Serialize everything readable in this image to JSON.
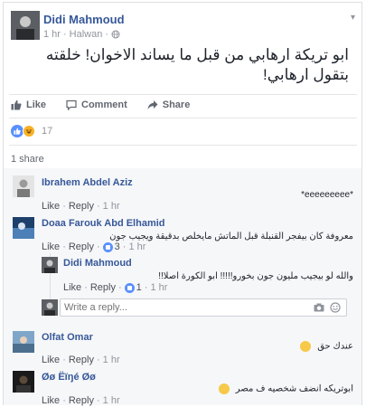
{
  "post": {
    "author": "Didi Mahmoud",
    "time": "1 hr",
    "location": "Halwan",
    "text": "ابو تريكة ارهابي من قبل ما يساند الاخوان! خلقته بتقول ارهابي!"
  },
  "actions": {
    "like": "Like",
    "comment": "Comment",
    "share": "Share"
  },
  "reactions": {
    "count": "17"
  },
  "shares": {
    "text": "1 share"
  },
  "comments": [
    {
      "name": "Ibrahem Abdel Aziz",
      "text": "*eeeeeeeee*",
      "like": "Like",
      "reply": "Reply",
      "time": "1 hr"
    },
    {
      "name": "Doaa Farouk Abd Elhamid",
      "text": "معروفة كان بيفجر القنبلة قبل الماتش مايخلص بدقيقة ويجيب جون",
      "like": "Like",
      "reply": "Reply",
      "reactions": "3",
      "time": "1 hr"
    },
    {
      "name": "Didi Mahmoud",
      "text": "والله لو بيجيب مليون جون بخورو!!!!! ابو الكورة اصلا!!",
      "like": "Like",
      "reply": "Reply",
      "reactions": "1",
      "time": "1 hr"
    },
    {
      "name": "Olfat Omar",
      "text": "عندك حق",
      "like": "Like",
      "reply": "Reply",
      "time": "1 hr"
    },
    {
      "name": "Øø Ëïŋé Øø",
      "text": "ابوتريكه انضف شخصيه ف مصر",
      "like": "Like",
      "reply": "Reply",
      "time": "1 hr"
    }
  ],
  "reply_box": {
    "placeholder": "Write a reply..."
  },
  "colors": {
    "link": "#365899",
    "like_blue": "#5890ff",
    "muted": "#90949c"
  }
}
